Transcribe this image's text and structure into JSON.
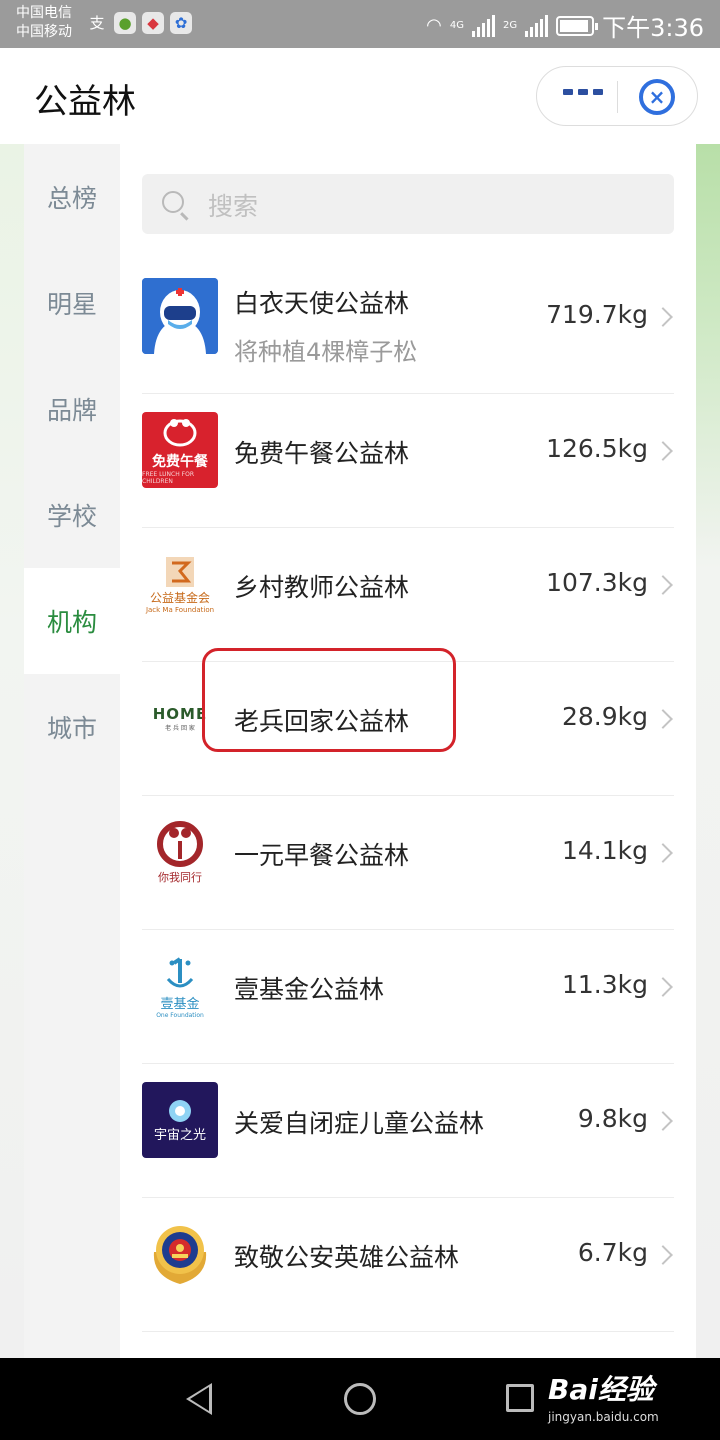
{
  "status_bar": {
    "carrier1": "中国电信",
    "carrier2": "中国移动",
    "signal1": "4G",
    "signal2": "2G",
    "time": "下午3:36"
  },
  "header": {
    "title": "公益林",
    "more_icon": "more-dots-icon",
    "close_icon": "close-capsule-icon"
  },
  "sidebar": {
    "items": [
      {
        "label": "总榜"
      },
      {
        "label": "明星"
      },
      {
        "label": "品牌"
      },
      {
        "label": "学校"
      },
      {
        "label": "机构",
        "active": true
      },
      {
        "label": "城市"
      }
    ]
  },
  "search": {
    "placeholder": "搜索"
  },
  "list": [
    {
      "title": "白衣天使公益林",
      "subtitle": "将种植4棵樟子松",
      "value": "719.7kg",
      "logo": "angel-logo"
    },
    {
      "title": "免费午餐公益林",
      "value": "126.5kg",
      "logo": "free-lunch-logo",
      "logo_text": "免费午餐",
      "logo_sub": "FREE LUNCH FOR CHILDREN"
    },
    {
      "title": "乡村教师公益林",
      "value": "107.3kg",
      "logo": "jack-ma-foundation-logo",
      "logo_text": "公益基金会",
      "logo_sub": "Jack Ma Foundation"
    },
    {
      "title": "老兵回家公益林",
      "value": "28.9kg",
      "logo": "home-logo",
      "logo_text": "HOME",
      "logo_sub": "老 兵 回 家"
    },
    {
      "title": "一元早餐公益林",
      "value": "14.1kg",
      "logo": "one-yuan-breakfast-logo",
      "logo_text": "你我同行"
    },
    {
      "title": "壹基金公益林",
      "value": "11.3kg",
      "logo": "one-foundation-logo",
      "logo_text": "壹基金",
      "logo_sub": "One Foundation"
    },
    {
      "title": "关爱自闭症儿童公益林",
      "value": "9.8kg",
      "logo": "cosmos-light-logo",
      "logo_text": "宇宙之光"
    },
    {
      "title": "致敬公安英雄公益林",
      "value": "6.7kg",
      "logo": "police-badge-logo"
    }
  ],
  "watermark": {
    "brand": "Bai经验",
    "url": "jingyan.baidu.com"
  },
  "colors": {
    "accent_green": "#2a8c3f",
    "highlight_red": "#d3232a",
    "capsule_blue": "#2f6fde"
  }
}
